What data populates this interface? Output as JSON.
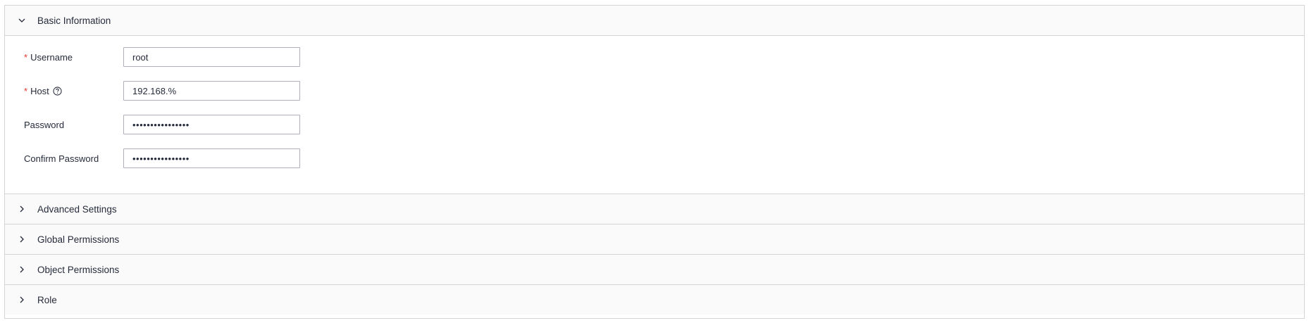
{
  "sections": {
    "basic": {
      "title": "Basic Information",
      "expanded": true
    },
    "advanced": {
      "title": "Advanced Settings"
    },
    "global": {
      "title": "Global Permissions"
    },
    "object": {
      "title": "Object Permissions"
    },
    "role": {
      "title": "Role"
    }
  },
  "form": {
    "required_mark": "*",
    "username": {
      "label": "Username",
      "value": "root"
    },
    "host": {
      "label": "Host",
      "value": "192.168.%",
      "help_icon": "question-circle-icon"
    },
    "password": {
      "label": "Password",
      "value": "••••••••••••••••"
    },
    "confirm_password": {
      "label": "Confirm Password",
      "value": "••••••••••••••••"
    }
  },
  "colors": {
    "required": "#e5342d",
    "border": "#d4d4d4",
    "header_bg": "#fafafa",
    "input_border": "#adb0b8"
  }
}
